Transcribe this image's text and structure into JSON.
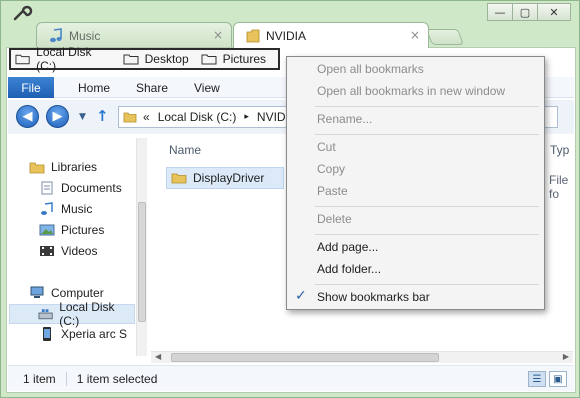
{
  "window": {
    "title_bar": {
      "wrench_icon": "wrench-icon"
    },
    "controls": {
      "minimize": "—",
      "restore": "▢",
      "close": "✕"
    }
  },
  "tabs": [
    {
      "label": "Music",
      "icon": "music-note-icon",
      "close": "×"
    },
    {
      "label": "NVIDIA",
      "icon": "folder-icon",
      "close": "×"
    }
  ],
  "bookmarks_bar": {
    "items": [
      {
        "label": "Local Disk (C:)"
      },
      {
        "label": "Desktop"
      },
      {
        "label": "Pictures"
      }
    ]
  },
  "ribbon": {
    "file": "File",
    "tabs": [
      "Home",
      "Share",
      "View"
    ]
  },
  "address_bar": {
    "chevrons": "«",
    "segments": [
      "Local Disk (C:)",
      "NVIDI"
    ],
    "separator": "▸"
  },
  "navigation_pane": {
    "items": [
      {
        "label": "Libraries",
        "icon": "libraries-icon"
      },
      {
        "label": "Documents",
        "icon": "documents-icon"
      },
      {
        "label": "Music",
        "icon": "music-icon"
      },
      {
        "label": "Pictures",
        "icon": "pictures-icon"
      },
      {
        "label": "Videos",
        "icon": "videos-icon"
      },
      {
        "label": "Computer",
        "icon": "computer-icon"
      },
      {
        "label": "Local Disk (C:)",
        "icon": "disk-icon",
        "selected": true
      },
      {
        "label": "Xperia arc S",
        "icon": "phone-icon"
      }
    ]
  },
  "file_list": {
    "columns": [
      "Name",
      "Typ"
    ],
    "rows": [
      {
        "name": "DisplayDriver",
        "type": "File fo"
      }
    ]
  },
  "status_bar": {
    "count": "1 item",
    "selection": "1 item selected"
  },
  "context_menu": {
    "groups": [
      [
        {
          "label": "Open all bookmarks",
          "enabled": false
        },
        {
          "label": "Open all bookmarks in new window",
          "enabled": false
        }
      ],
      [
        {
          "label": "Rename...",
          "enabled": false
        }
      ],
      [
        {
          "label": "Cut",
          "enabled": false
        },
        {
          "label": "Copy",
          "enabled": false
        },
        {
          "label": "Paste",
          "enabled": false
        }
      ],
      [
        {
          "label": "Delete",
          "enabled": false
        }
      ],
      [
        {
          "label": "Add page...",
          "enabled": true
        },
        {
          "label": "Add folder...",
          "enabled": true
        }
      ],
      [
        {
          "label": "Show bookmarks bar",
          "enabled": true,
          "checked": true
        }
      ]
    ],
    "check_glyph": "✓"
  },
  "colors": {
    "chrome_frame": "#cfe8c8",
    "ribbon_file": "#1f5fb3",
    "selection": "#dbe9f8"
  }
}
